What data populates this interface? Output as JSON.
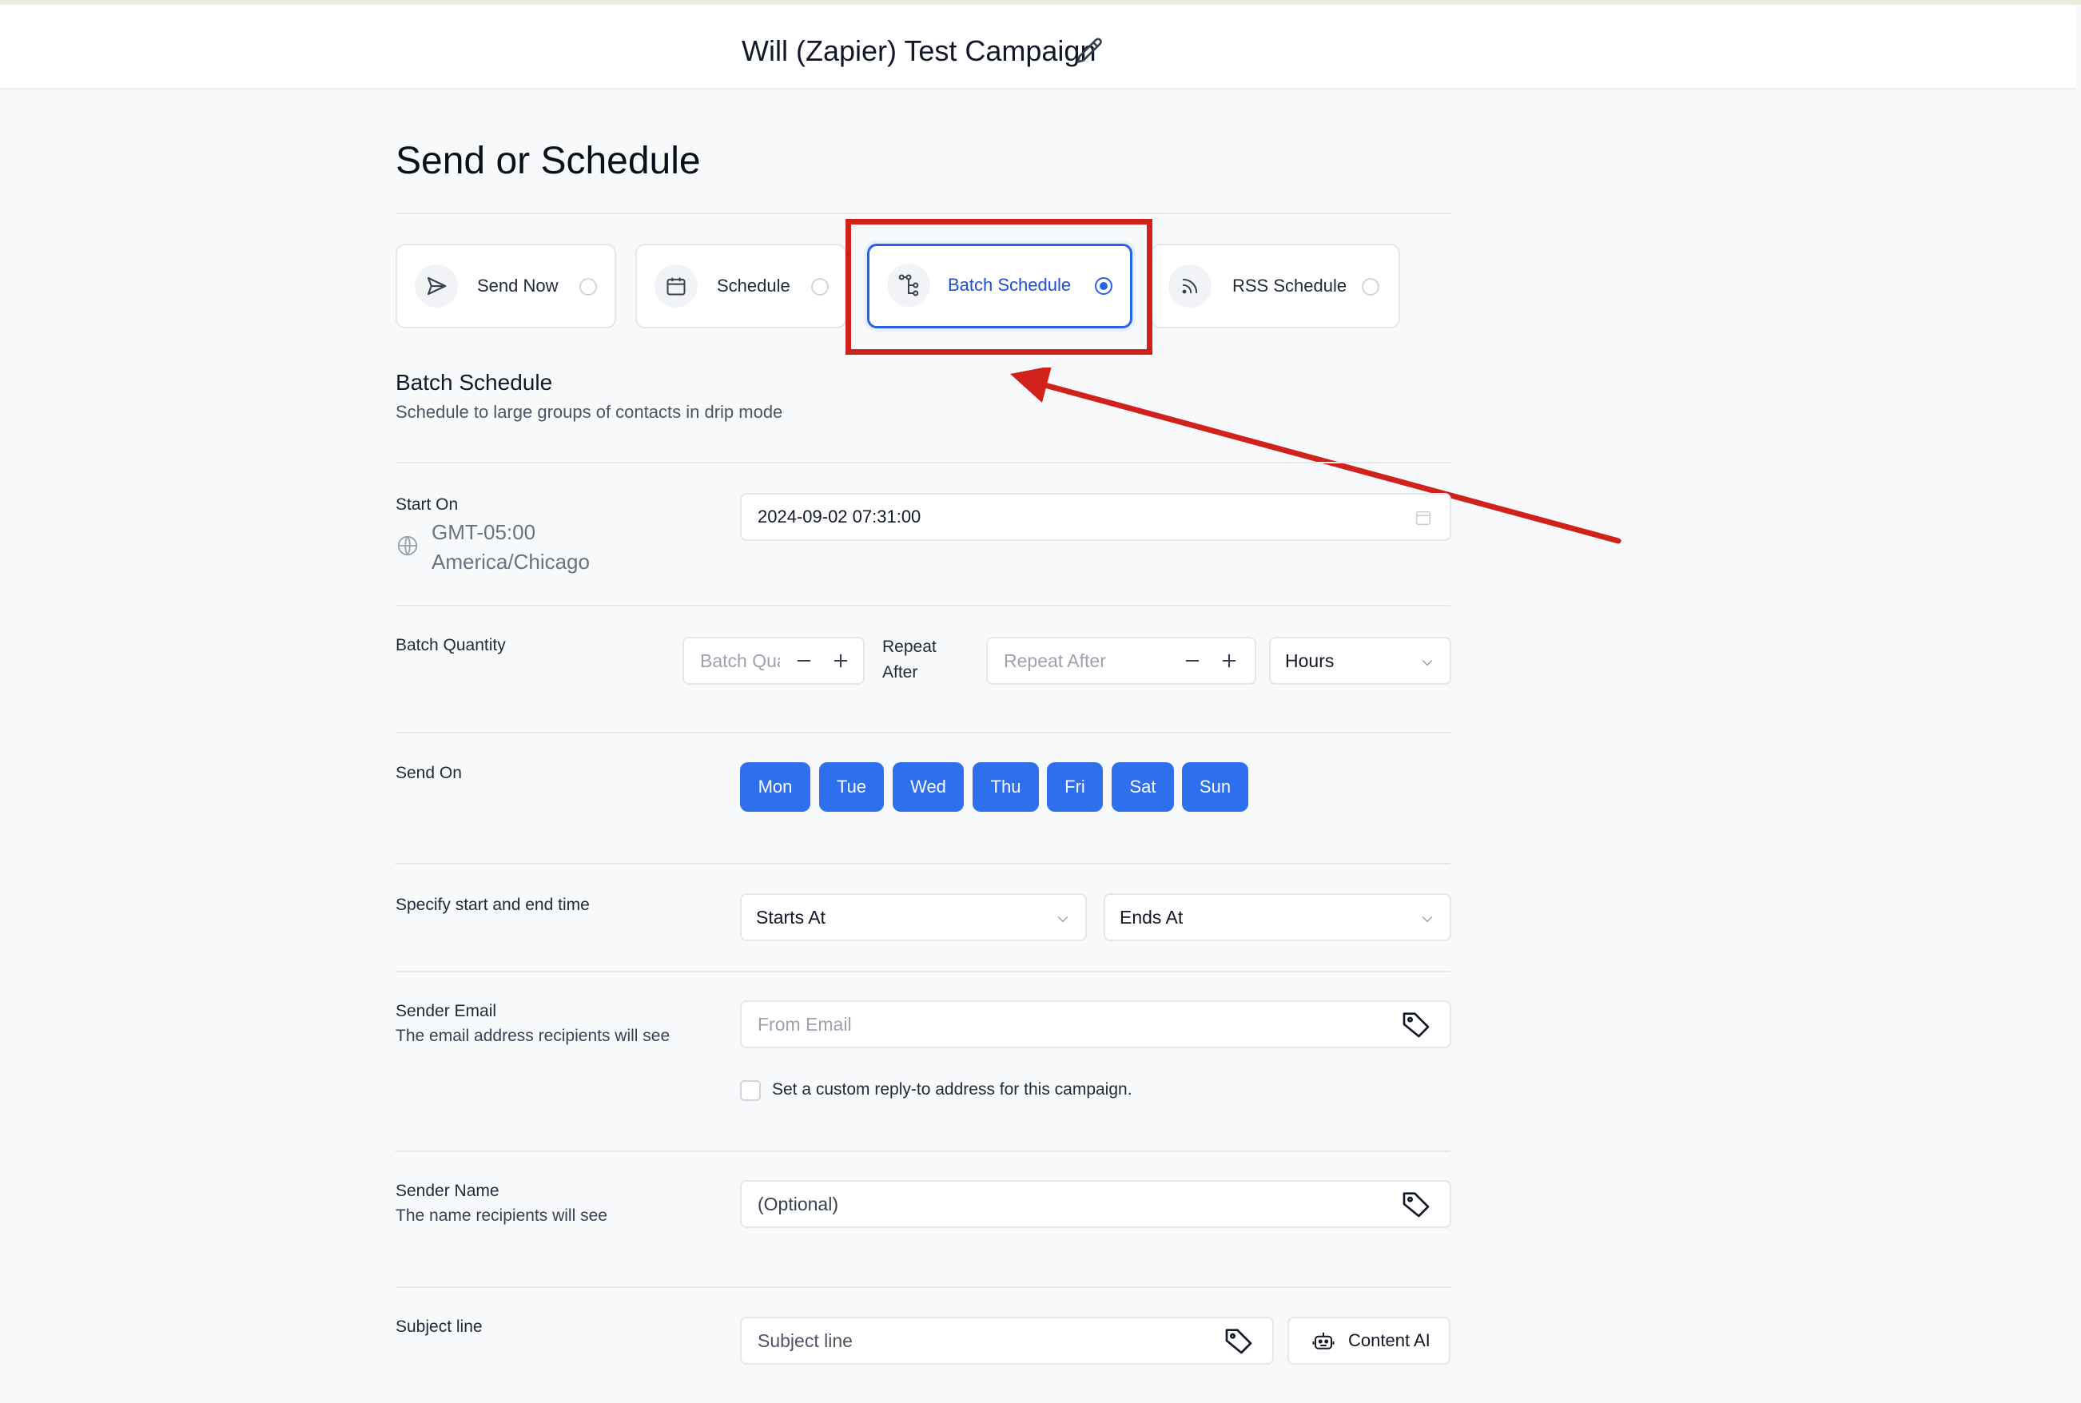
{
  "header": {
    "campaign_title": "Will (Zapier) Test Campaign"
  },
  "page": {
    "title": "Send or Schedule"
  },
  "send_options": [
    {
      "label": "Send Now",
      "icon": "send-icon",
      "selected": false
    },
    {
      "label": "Schedule",
      "icon": "calendar-icon",
      "selected": false
    },
    {
      "label": "Batch Schedule",
      "icon": "batch-tree-icon",
      "selected": true
    },
    {
      "label": "RSS Schedule",
      "icon": "rss-icon",
      "selected": false
    }
  ],
  "section": {
    "title": "Batch Schedule",
    "subtitle": "Schedule to large groups of contacts in drip mode"
  },
  "start_on": {
    "label": "Start On",
    "tz_offset": "GMT-05:00",
    "tz_name": "America/Chicago",
    "value": "2024-09-02 07:31:00"
  },
  "batch": {
    "label": "Batch Quantity",
    "quantity_placeholder": "Batch Qua",
    "repeat_label_line1": "Repeat",
    "repeat_label_line2": "After",
    "repeat_placeholder": "Repeat After",
    "unit": "Hours"
  },
  "send_on": {
    "label": "Send On",
    "days": [
      "Mon",
      "Tue",
      "Wed",
      "Thu",
      "Fri",
      "Sat",
      "Sun"
    ]
  },
  "time_window": {
    "label": "Specify start and end time",
    "starts_at": "Starts At",
    "ends_at": "Ends At"
  },
  "sender_email": {
    "label": "Sender Email",
    "sublabel": "The email address recipients will see",
    "placeholder": "From Email",
    "reply_to_label": "Set a custom reply-to address for this campaign."
  },
  "sender_name": {
    "label": "Sender Name",
    "sublabel": "The name recipients will see",
    "placeholder": "(Optional)"
  },
  "subject": {
    "label": "Subject line",
    "placeholder": "Subject line",
    "content_ai_label": "Content AI"
  },
  "colors": {
    "accent": "#2563eb",
    "day_button": "#2d6fec",
    "annotation_red": "#d0211b"
  }
}
